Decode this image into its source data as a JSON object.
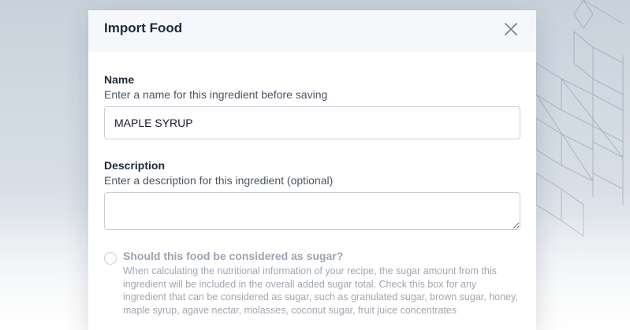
{
  "modal": {
    "title": "Import Food"
  },
  "name_field": {
    "label": "Name",
    "hint": "Enter a name for this ingredient before saving",
    "value": "MAPLE SYRUP"
  },
  "description_field": {
    "label": "Description",
    "hint": "Enter a description for this ingredient (optional)",
    "value": ""
  },
  "sugar_option": {
    "label": "Should this food be considered as sugar?",
    "description": "When calculating the nutritional information of your recipe, the sugar amount from this ingredient will be included in the overall added sugar total. Check this box for any ingredient that can be considered as sugar, such as granulated sugar, brown sugar, honey, maple syrup, agave nectar, molasses, coconut sugar, fruit juice concentrates",
    "checked": false
  },
  "icons": {
    "close": "close-icon"
  }
}
